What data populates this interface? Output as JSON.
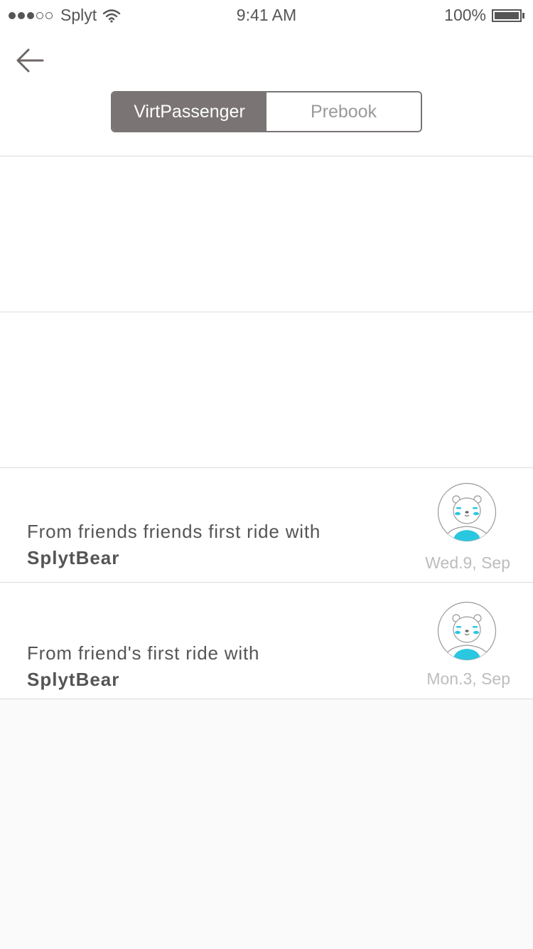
{
  "status_bar": {
    "carrier": "Splyt",
    "time": "9:41 AM",
    "battery": "100%"
  },
  "nav": {
    "back_icon": "arrow-left-icon"
  },
  "tabs": [
    {
      "label": "VirtPassenger",
      "active": true
    },
    {
      "label": "Prebook",
      "active": false
    }
  ],
  "messages": [
    {
      "text": "From friends friends first ride with",
      "name": "SplytBear",
      "date": "Wed.9, Sep",
      "avatar_icon": "bear-avatar-icon"
    },
    {
      "text": "From friend's first ride with",
      "name": "SplytBear",
      "date": "Mon.3, Sep",
      "avatar_icon": "bear-avatar-icon"
    }
  ],
  "colors": {
    "accent": "#7a7474",
    "avatar_blue": "#29c7e0"
  }
}
